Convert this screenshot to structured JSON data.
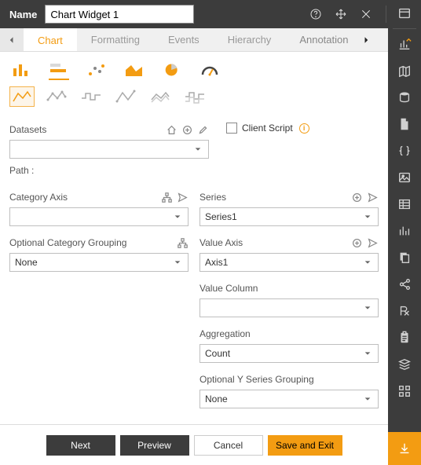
{
  "header": {
    "name_label": "Name",
    "name_value": "Chart Widget 1"
  },
  "tabs": {
    "chart": "Chart",
    "formatting": "Formatting",
    "events": "Events",
    "hierarchy": "Hierarchy",
    "annotation": "Annotation"
  },
  "labels": {
    "datasets": "Datasets",
    "path_label": "Path :",
    "client_script": "Client Script",
    "category_axis": "Category Axis",
    "optional_category_grouping": "Optional Category Grouping",
    "series": "Series",
    "value_axis": "Value Axis",
    "value_column": "Value Column",
    "aggregation": "Aggregation",
    "optional_y_series_grouping": "Optional Y Series Grouping"
  },
  "values": {
    "datasets": "",
    "category_axis": "",
    "optional_category_grouping": "None",
    "series": "Series1",
    "value_axis": "Axis1",
    "value_column": "",
    "aggregation": "Count",
    "optional_y_series_grouping": "None"
  },
  "footer": {
    "next": "Next",
    "preview": "Preview",
    "cancel": "Cancel",
    "save_exit": "Save and Exit"
  },
  "colors": {
    "accent": "#f39c12"
  }
}
